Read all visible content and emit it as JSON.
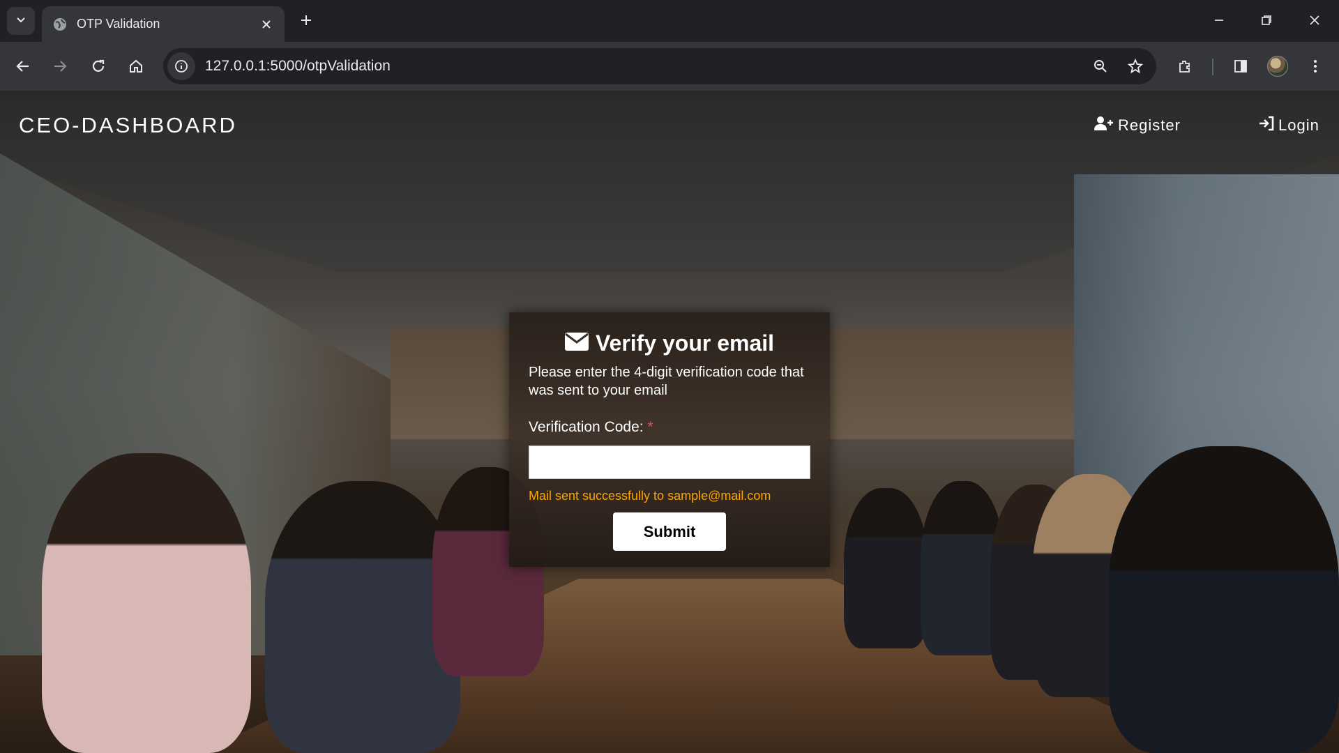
{
  "browser": {
    "tab_title": "OTP Validation",
    "url": "127.0.0.1:5000/otpValidation"
  },
  "navbar": {
    "brand": "CEO-DASHBOARD",
    "register_label": "Register",
    "login_label": "Login"
  },
  "card": {
    "title": "Verify your email",
    "description": "Please enter the 4-digit verification code that was sent to your email",
    "code_label": "Verification Code:",
    "required_marker": "*",
    "code_value": "",
    "status_message": "Mail sent successfully to sample@mail.com",
    "submit_label": "Submit"
  },
  "colors": {
    "status": "#ffa500",
    "required": "#d9534f",
    "chrome_dark": "#202124",
    "chrome_toolbar": "#35363a"
  }
}
